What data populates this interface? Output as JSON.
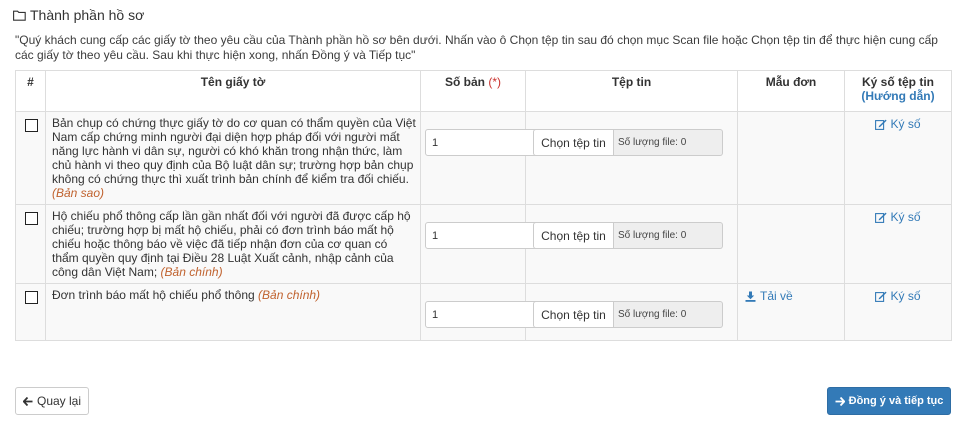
{
  "section": {
    "icon": "folder-open-icon",
    "title": "Thành phần hồ sơ",
    "instruction": "\"Quý khách cung cấp các giấy tờ theo yêu cầu của Thành phần hồ sơ bên dưới. Nhấn vào ô Chọn tệp tin sau đó chọn mục Scan file hoặc Chọn tệp tin để thực hiện cung cấp các giấy tờ theo yêu cầu. Sau khi thực hiện xong, nhấn Đồng ý và Tiếp tục\""
  },
  "table": {
    "headers": {
      "index": "#",
      "name": "Tên giấy tờ",
      "copies": "Số bản",
      "copies_required_mark": "(*)",
      "file": "Tệp tin",
      "template": "Mẫu đơn",
      "sign": "Ký số tệp tin",
      "sign_guide": "(Hướng dẫn)"
    },
    "rows": [
      {
        "name": "Bản chụp có chứng thực giấy tờ do cơ quan có thẩm quyền của Việt Nam cấp chứng minh người đại diện hợp pháp đối với người mất năng lực hành vi dân sự, người có khó khăn trong nhận thức, làm chủ hành vi theo quy định của Bộ luật dân sự; trường hợp bản chụp không có chứng thực thì xuất trình bản chính để kiểm tra đối chiếu.",
        "kind": "(Bản sao)",
        "copies": "1",
        "file_button": "Chọn tệp tin",
        "file_count": "Số lượng file: 0",
        "template": "",
        "sign": "Ký số"
      },
      {
        "name": "Hộ chiếu phổ thông cấp lần gần nhất đối với người đã được cấp hộ chiếu; trường hợp bị mất hộ chiếu, phải có đơn trình báo mất hộ chiếu hoặc thông báo về việc đã tiếp nhận đơn của cơ quan có thẩm quyền quy định tại Điều 28 Luật Xuất cảnh, nhập cảnh của công dân Việt Nam;",
        "kind": "(Bản chính)",
        "copies": "1",
        "file_button": "Chọn tệp tin",
        "file_count": "Số lượng file: 0",
        "template": "",
        "sign": "Ký số"
      },
      {
        "name": "Đơn trình báo mất hộ chiếu phổ thông",
        "kind": "(Bản chính)",
        "copies": "1",
        "file_button": "Chọn tệp tin",
        "file_count": "Số lượng file: 0",
        "template": "Tải về",
        "sign": "Ký số"
      }
    ]
  },
  "actions": {
    "back": "Quay lại",
    "next": "Đồng ý và tiếp tục"
  },
  "colors": {
    "link": "#337ab7",
    "primary_button": "#337ab7",
    "required": "#c9302c",
    "kind_label": "#c0622e"
  }
}
